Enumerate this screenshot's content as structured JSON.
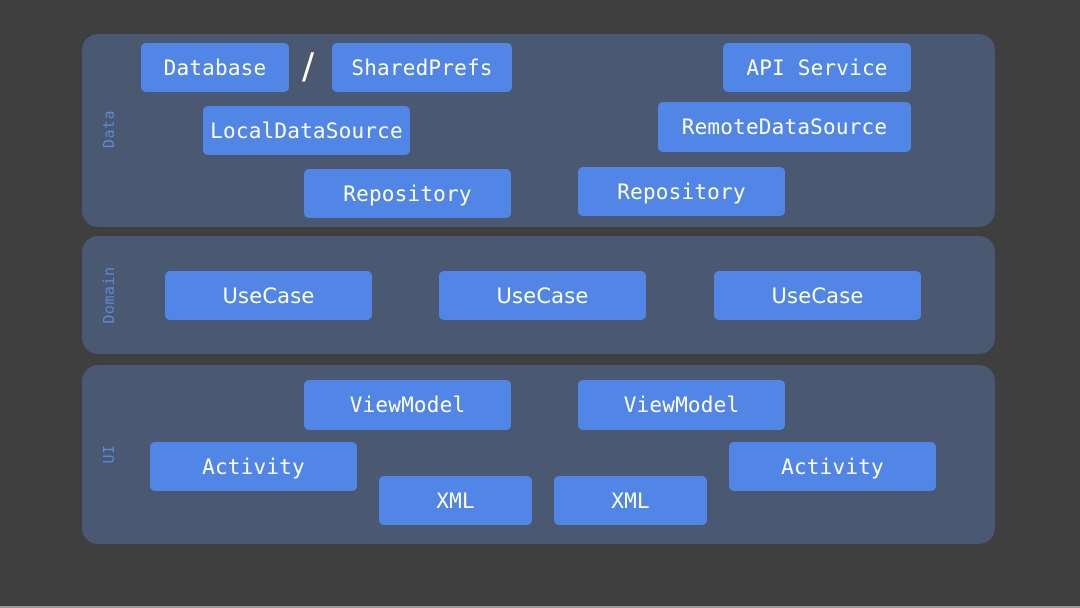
{
  "layers": {
    "data": {
      "label": "Data",
      "boxes": {
        "database": "Database",
        "separator": "/",
        "shared_prefs": "SharedPrefs",
        "api_service": "API Service",
        "local_data_source": "LocalDataSource",
        "remote_data_source": "RemoteDataSource",
        "repository_left": "Repository",
        "repository_right": "Repository"
      }
    },
    "domain": {
      "label": "Domain",
      "boxes": [
        "UseCase",
        "UseCase",
        "UseCase"
      ]
    },
    "ui": {
      "label": "UI",
      "boxes": {
        "viewmodel_left": "ViewModel",
        "viewmodel_right": "ViewModel",
        "activity_left": "Activity",
        "activity_right": "Activity",
        "xml_left": "XML",
        "xml_right": "XML"
      }
    }
  },
  "colors": {
    "background": "#3f3f3f",
    "panel": "#4a5872",
    "box": "#5286e6",
    "layer_label": "#5b8ad6",
    "box_text": "#ffffff"
  }
}
